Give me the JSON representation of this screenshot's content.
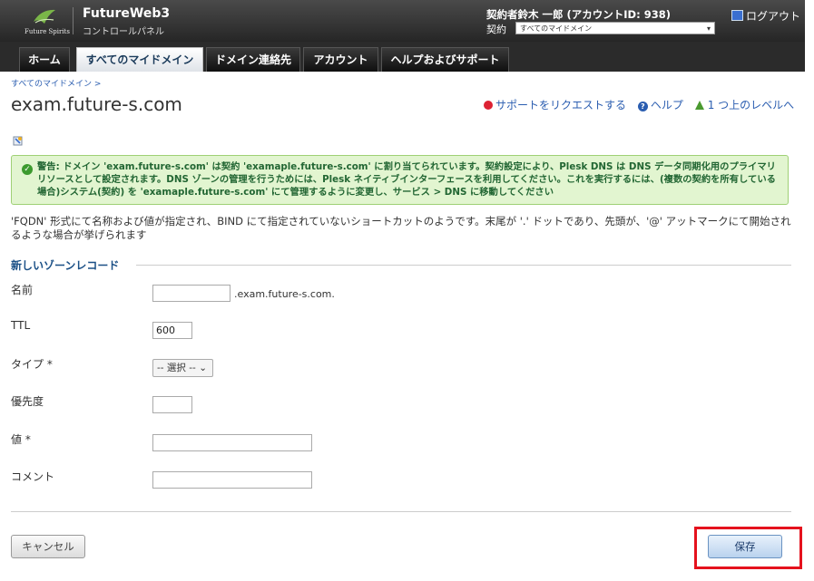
{
  "header": {
    "logo_text": "Future Spirits",
    "brand_title": "FutureWeb3",
    "brand_subtitle": "コントロールパネル",
    "user_info": "契約者鈴木 一郎 (アカウントID: 938)",
    "subscription_label": "契約",
    "subscription_value": "すべてのマイドメイン",
    "logout_label": "ログアウト"
  },
  "nav": {
    "tabs": [
      {
        "label": "ホーム",
        "active": false
      },
      {
        "label": "すべてのマイドメイン",
        "active": true
      },
      {
        "label": "ドメイン連絡先",
        "active": false
      },
      {
        "label": "アカウント",
        "active": false
      },
      {
        "label": "ヘルプおよびサポート",
        "active": false
      }
    ]
  },
  "page": {
    "breadcrumb": "すべてのマイドメイン >",
    "title": "exam.future-s.com",
    "actions": {
      "support": "サポートをリクエストする",
      "help": "ヘルプ",
      "up_level": "1 つ上のレベルへ"
    }
  },
  "warning": {
    "text": "警告: ドメイン 'exam.future-s.com' は契約 'examaple.future-s.com' に割り当てられています。契約設定により、Plesk DNS は DNS データ同期化用のプライマリリソースとして設定されます。DNS ゾーンの管理を行うためには、Plesk ネイティブインターフェースを利用してください。これを実行するには、(複数の契約を所有している場合)システム(契約) を 'examaple.future-s.com' にて管理するように変更し、サービス > DNS に移動してください"
  },
  "description": "'FQDN' 形式にて名称および値が指定され、BIND にて指定されていないショートカットのようです。末尾が '.' ドットであり、先頭が、'@' アットマークにて開始されるような場合が挙げられます",
  "form": {
    "section_title": "新しいゾーンレコード",
    "name_label": "名前",
    "name_value": "",
    "name_suffix": ".exam.future-s.com.",
    "ttl_label": "TTL",
    "ttl_value": "600",
    "type_label": "タイプ *",
    "type_value": "-- 選択 --",
    "priority_label": "優先度",
    "priority_value": "",
    "value_label": "値 *",
    "value_value": "",
    "comment_label": "コメント",
    "comment_value": ""
  },
  "buttons": {
    "cancel": "キャンセル",
    "save": "保存"
  },
  "colors": {
    "header_bg": "#2b2b2b",
    "link": "#2a5db0",
    "warning_bg": "#e2f5d0",
    "highlight": "#e5121d"
  }
}
